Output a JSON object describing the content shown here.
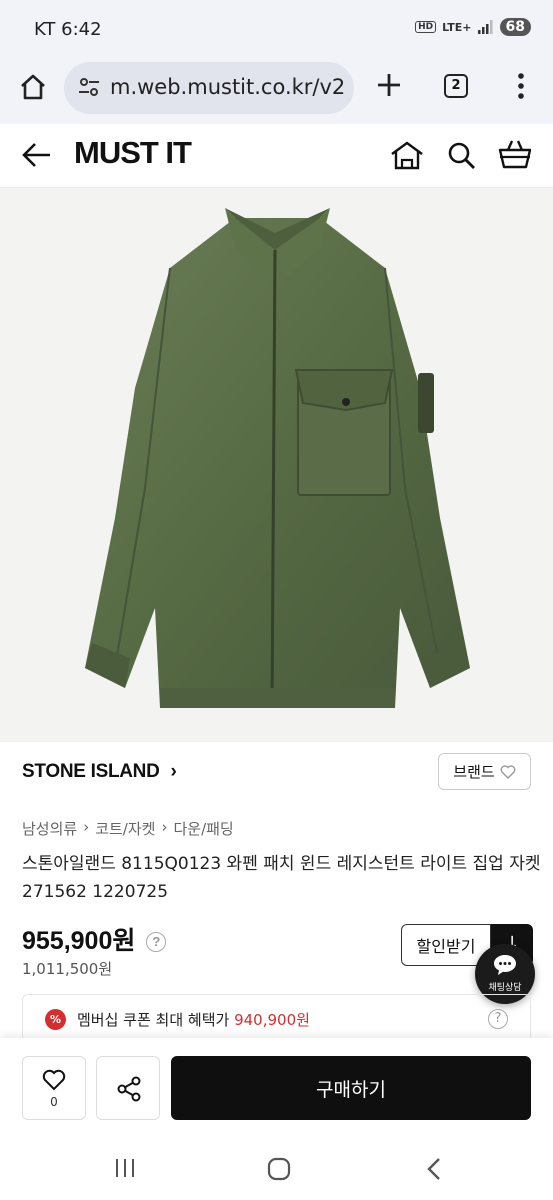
{
  "status_bar": {
    "carrier": "KT",
    "time": "6:42",
    "hd": "HD",
    "network": "LTE+",
    "battery": "68"
  },
  "browser": {
    "url": "m.web.mustit.co.kr/v2",
    "tab_count": "2"
  },
  "header": {
    "logo": "MUST IT"
  },
  "product": {
    "brand": "STONE ISLAND",
    "brand_button": "브랜드",
    "breadcrumb": [
      "남성의류",
      "코트/자켓",
      "다운/패딩"
    ],
    "title": "스톤아일랜드 8115Q0123 와펜 패치 윈드 레지스턴트 라이트 집업 자켓 271562 1220725",
    "price": "955,900원",
    "original_price": "1,011,500원",
    "discount_button": "할인받기",
    "discount_arrow": "↓"
  },
  "chat": {
    "label": "채팅상담"
  },
  "coupon": {
    "badge": "%",
    "text": "멤버십 쿠폰 최대 혜택가",
    "amount": "940,900원"
  },
  "actions": {
    "like_count": "0",
    "buy_label": "구매하기"
  },
  "icons": {
    "home": "home-icon",
    "tune": "tune-icon",
    "add": "plus-icon",
    "menu": "more-vert-icon",
    "back": "back-arrow-icon",
    "shop": "store-icon",
    "search": "search-icon",
    "cart": "basket-icon",
    "heart": "heart-icon",
    "share": "share-icon",
    "help": "question-icon",
    "recents": "recents-icon",
    "nav_home": "nav-home-icon",
    "nav_back": "nav-back-icon"
  },
  "colors": {
    "accent_red": "#d32f2f",
    "button_dark": "#0f0f0f",
    "jacket_green": "#5b6e4a"
  }
}
